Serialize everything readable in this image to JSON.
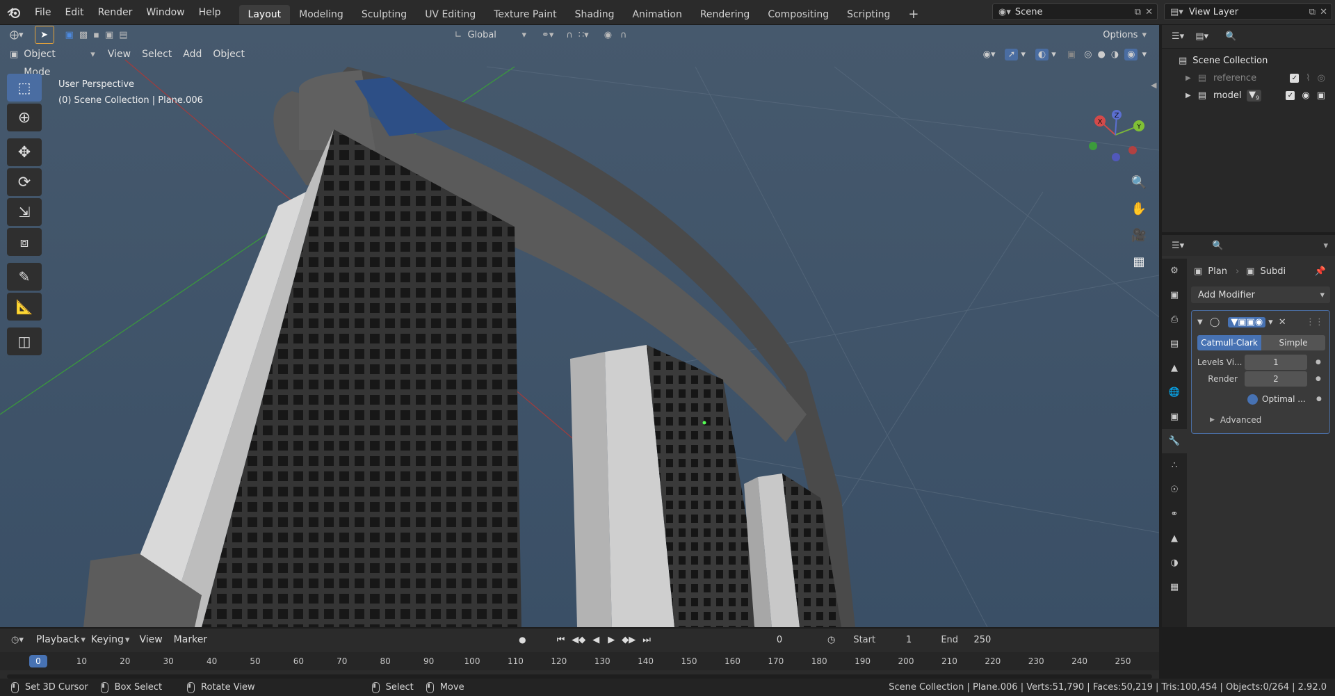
{
  "menu": [
    "File",
    "Edit",
    "Render",
    "Window",
    "Help"
  ],
  "workspaces": [
    "Layout",
    "Modeling",
    "Sculpting",
    "UV Editing",
    "Texture Paint",
    "Shading",
    "Animation",
    "Rendering",
    "Compositing",
    "Scripting"
  ],
  "active_workspace": "Layout",
  "scene_name": "Scene",
  "view_layer": "View Layer",
  "toolbar": {
    "transform_orientation": "Global",
    "options": "Options"
  },
  "viewport_header": {
    "mode": "Object Mode",
    "view": "View",
    "select": "Select",
    "add": "Add",
    "object": "Object"
  },
  "viewport_overlay": {
    "line1": "User Perspective",
    "line2": "(0) Scene Collection | Plane.006"
  },
  "gizmo": {
    "x": "X",
    "y": "Y",
    "z": "Z"
  },
  "outliner": {
    "root": "Scene Collection",
    "items": [
      {
        "name": "reference"
      },
      {
        "name": "model",
        "badge": "9"
      }
    ]
  },
  "properties": {
    "breadcrumb_object": "Plan",
    "breadcrumb_modifier": "Subdi",
    "add_modifier": "Add Modifier",
    "subdiv_types": [
      "Catmull-Clark",
      "Simple"
    ],
    "active_type": "Catmull-Clark",
    "levels_viewport_label": "Levels Vi...",
    "levels_viewport_value": "1",
    "render_label": "Render",
    "render_value": "2",
    "optimal_label": "Optimal ...",
    "advanced_label": "Advanced"
  },
  "timeline": {
    "playback": "Playback",
    "keying": "Keying",
    "view": "View",
    "marker": "Marker",
    "current_frame": "0",
    "start_label": "Start",
    "start": "1",
    "end_label": "End",
    "end": "250",
    "ticks": [
      "0",
      "10",
      "20",
      "30",
      "40",
      "50",
      "60",
      "70",
      "80",
      "90",
      "100",
      "110",
      "120",
      "130",
      "140",
      "150",
      "160",
      "170",
      "180",
      "190",
      "200",
      "210",
      "220",
      "230",
      "240",
      "250"
    ]
  },
  "statusbar": {
    "left": [
      "Set 3D Cursor",
      "Box Select",
      "Rotate View"
    ],
    "mid": [
      "Select",
      "Move"
    ],
    "stats": "Scene Collection | Plane.006 | Verts:51,790 | Faces:50,219 | Tris:100,454 | Objects:0/264 | 2.92.0"
  },
  "colors": {
    "accent": "#4a6da2",
    "header": "#2b2b2b",
    "sky": "#3b5068",
    "active_blue": "#4772b3"
  }
}
